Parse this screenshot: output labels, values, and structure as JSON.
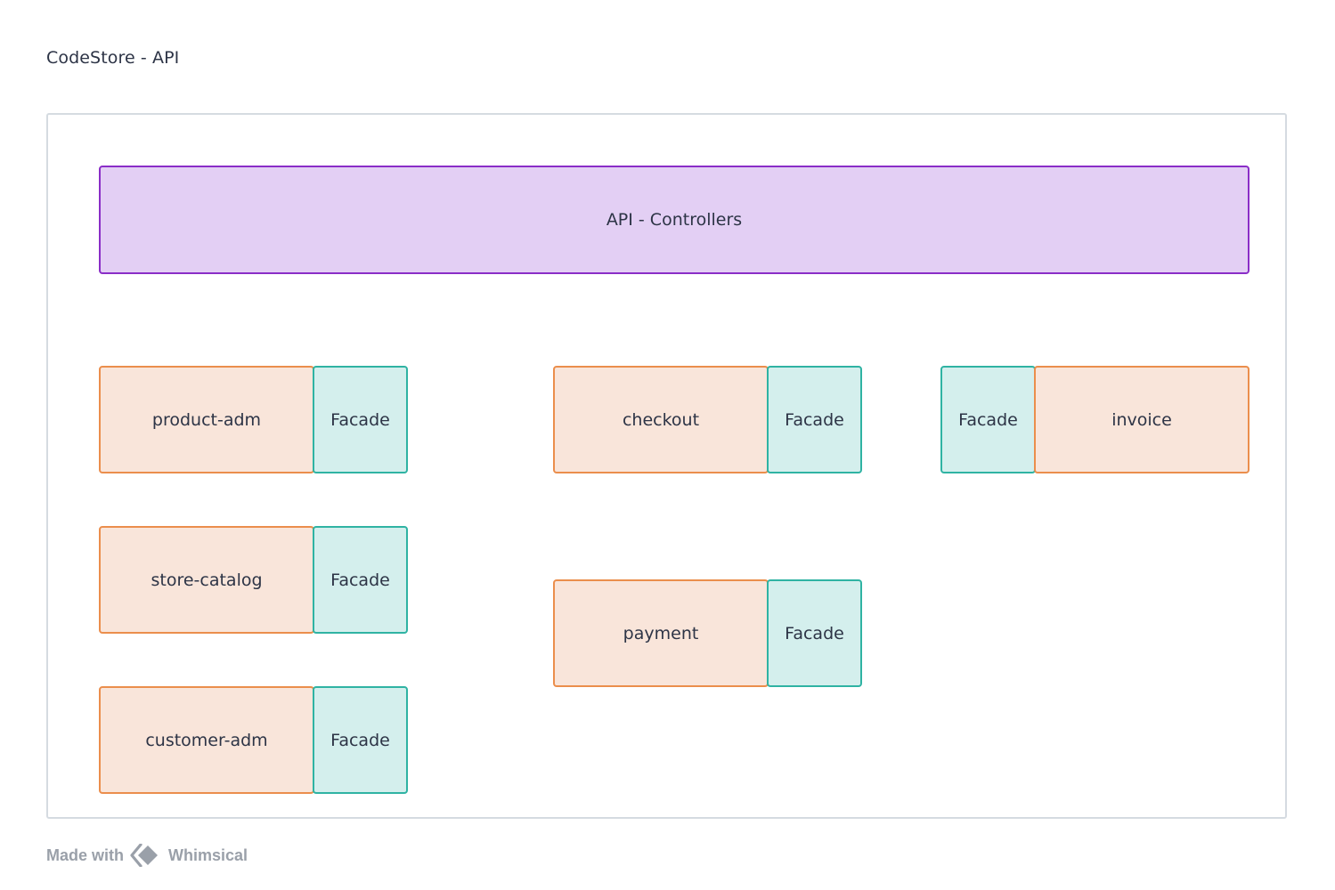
{
  "title": "CodeStore - API",
  "controllers": {
    "label": "API - Controllers"
  },
  "modules": {
    "product_adm": {
      "label": "product-adm",
      "facade": "Facade"
    },
    "store_catalog": {
      "label": "store-catalog",
      "facade": "Facade"
    },
    "customer_adm": {
      "label": "customer-adm",
      "facade": "Facade"
    },
    "checkout": {
      "label": "checkout",
      "facade": "Facade"
    },
    "payment": {
      "label": "payment",
      "facade": "Facade"
    },
    "invoice": {
      "label": "invoice",
      "facade": "Facade"
    }
  },
  "footer": {
    "made_with": "Made with",
    "brand": "Whimsical"
  },
  "colors": {
    "controller_fill": "#e3cff4",
    "controller_border": "#8a2dc7",
    "module_fill": "#f9e5da",
    "module_border": "#eb8e4c",
    "facade_fill": "#d4efed",
    "facade_border": "#2fb3a3",
    "frame_border": "#d5dbe1"
  },
  "icons": {
    "footer_logo": "whimsical-logo-icon"
  }
}
